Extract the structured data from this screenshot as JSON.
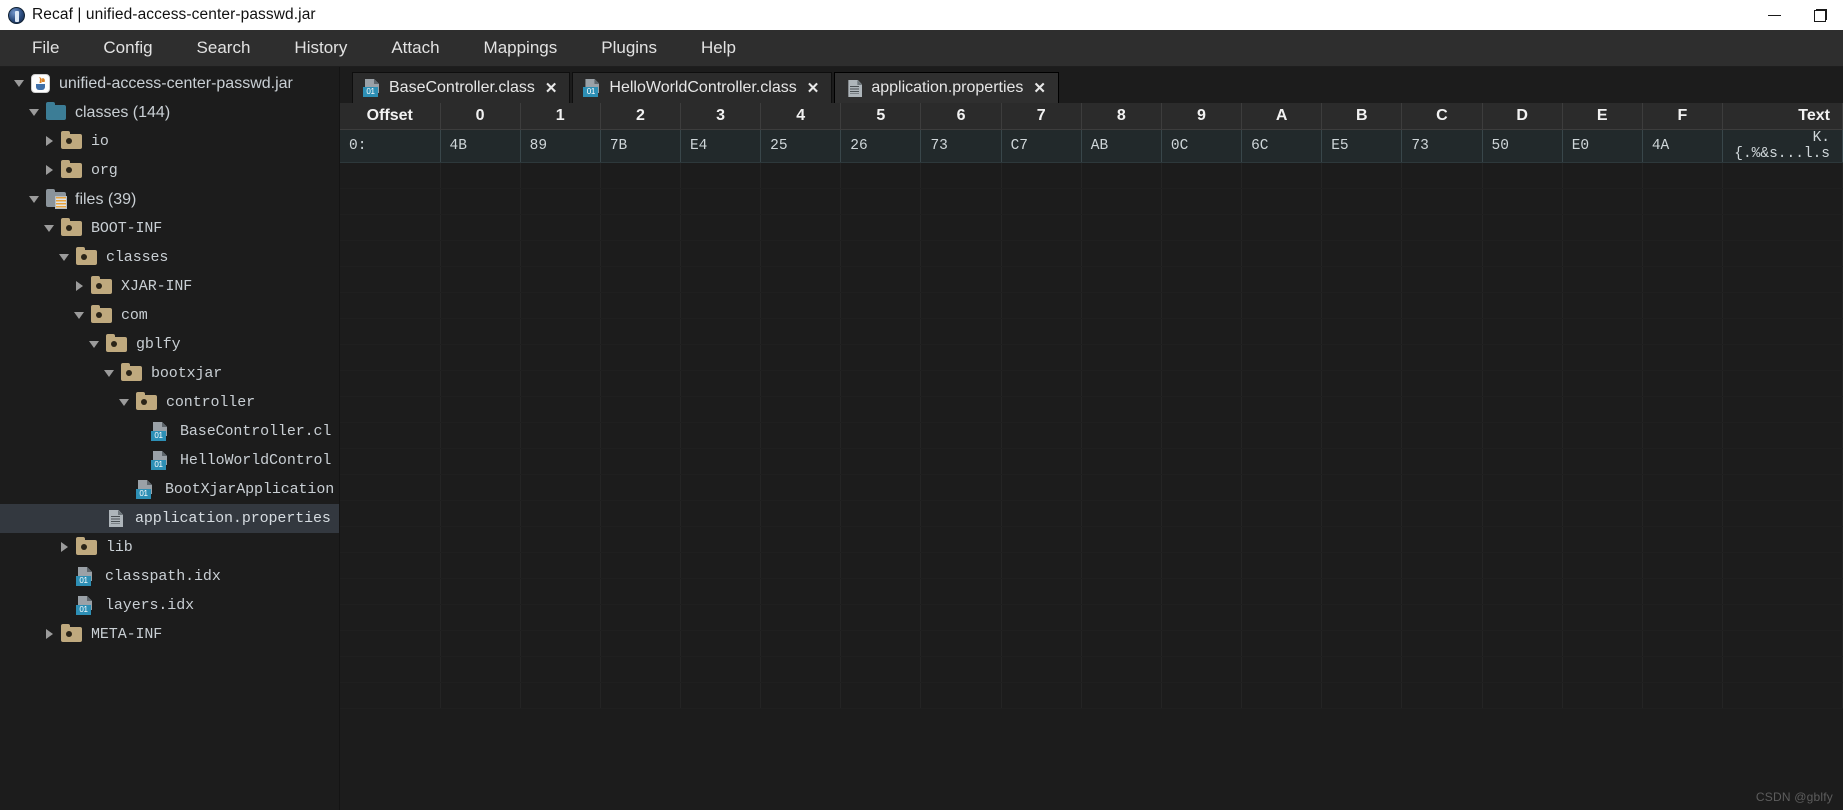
{
  "window": {
    "title": "Recaf | unified-access-center-passwd.jar",
    "app_icon": "recaf-logo-icon",
    "controls": [
      {
        "name": "minimize-button",
        "glyph": "minimize-icon"
      },
      {
        "name": "restore-button",
        "glyph": "restore-icon"
      }
    ]
  },
  "menubar": {
    "items": [
      {
        "label": "File"
      },
      {
        "label": "Config"
      },
      {
        "label": "Search"
      },
      {
        "label": "History"
      },
      {
        "label": "Attach"
      },
      {
        "label": "Mappings"
      },
      {
        "label": "Plugins"
      },
      {
        "label": "Help"
      }
    ]
  },
  "sidebar": {
    "items": [
      {
        "label": "unified-access-center-passwd.jar",
        "indent": 0,
        "twisty": "open",
        "icon": "jar-icon",
        "mono": false,
        "selected": false
      },
      {
        "label": "classes (144)",
        "indent": 1,
        "twisty": "open",
        "icon": "folder-teal-icon",
        "mono": false,
        "selected": false
      },
      {
        "label": "io",
        "indent": 2,
        "twisty": "closed",
        "icon": "folder-icon",
        "mono": true,
        "selected": false
      },
      {
        "label": "org",
        "indent": 2,
        "twisty": "closed",
        "icon": "folder-icon",
        "mono": true,
        "selected": false
      },
      {
        "label": "files (39)",
        "indent": 1,
        "twisty": "open",
        "icon": "folder-files-icon",
        "mono": false,
        "selected": false
      },
      {
        "label": "BOOT-INF",
        "indent": 2,
        "twisty": "open",
        "icon": "folder-icon",
        "mono": true,
        "selected": false
      },
      {
        "label": "classes",
        "indent": 3,
        "twisty": "open",
        "icon": "folder-icon",
        "mono": true,
        "selected": false
      },
      {
        "label": "XJAR-INF",
        "indent": 4,
        "twisty": "closed",
        "icon": "folder-icon",
        "mono": true,
        "selected": false
      },
      {
        "label": "com",
        "indent": 4,
        "twisty": "open",
        "icon": "folder-icon",
        "mono": true,
        "selected": false
      },
      {
        "label": "gblfy",
        "indent": 5,
        "twisty": "open",
        "icon": "folder-icon",
        "mono": true,
        "selected": false
      },
      {
        "label": "bootxjar",
        "indent": 6,
        "twisty": "open",
        "icon": "folder-icon",
        "mono": true,
        "selected": false
      },
      {
        "label": "controller",
        "indent": 7,
        "twisty": "open",
        "icon": "folder-icon",
        "mono": true,
        "selected": false
      },
      {
        "label": "BaseController.cl",
        "indent": 8,
        "twisty": "none",
        "icon": "class-file-icon",
        "mono": true,
        "selected": false
      },
      {
        "label": "HelloWorldControl",
        "indent": 8,
        "twisty": "none",
        "icon": "class-file-icon",
        "mono": true,
        "selected": false
      },
      {
        "label": "BootXjarApplication",
        "indent": 7,
        "twisty": "none",
        "icon": "class-file-icon",
        "mono": true,
        "selected": false
      },
      {
        "label": "application.properties",
        "indent": 5,
        "twisty": "none",
        "icon": "text-file-icon",
        "mono": true,
        "selected": true
      },
      {
        "label": "lib",
        "indent": 3,
        "twisty": "closed",
        "icon": "folder-icon",
        "mono": true,
        "selected": false
      },
      {
        "label": "classpath.idx",
        "indent": 3,
        "twisty": "none",
        "icon": "class-file-icon",
        "mono": true,
        "selected": false
      },
      {
        "label": "layers.idx",
        "indent": 3,
        "twisty": "none",
        "icon": "class-file-icon",
        "mono": true,
        "selected": false
      },
      {
        "label": "META-INF",
        "indent": 2,
        "twisty": "closed",
        "icon": "folder-icon",
        "mono": true,
        "selected": false
      }
    ]
  },
  "tabs": [
    {
      "label": "BaseController.class",
      "icon": "class-file-icon",
      "close": "✕",
      "active": false
    },
    {
      "label": "HelloWorldController.class",
      "icon": "class-file-icon",
      "close": "✕",
      "active": false
    },
    {
      "label": "application.properties",
      "icon": "text-file-icon",
      "close": "✕",
      "active": true
    }
  ],
  "hex_view": {
    "headers": [
      "Offset",
      "0",
      "1",
      "2",
      "3",
      "4",
      "5",
      "6",
      "7",
      "8",
      "9",
      "A",
      "B",
      "C",
      "D",
      "E",
      "F",
      "Text"
    ],
    "rows": [
      {
        "offset": "0:",
        "bytes": [
          "4B",
          "89",
          "7B",
          "E4",
          "25",
          "26",
          "73",
          "C7",
          "AB",
          "0C",
          "6C",
          "E5",
          "73",
          "50",
          "E0",
          "4A"
        ],
        "text": "K.{.%&s...l.s"
      }
    ],
    "blank_row_count": 21
  },
  "watermark": "CSDN @gblfy",
  "colors": {
    "titlebar_bg": "#ffffff",
    "menubar_bg": "#2e2e2e",
    "panel_bg": "#1c1c1c",
    "tab_active_bg": "#2f2f2f",
    "hex_header_bg": "#2b2b2b",
    "hex_row_bg": "#22292b",
    "selection_bg": "#33383f",
    "accent_teal": "#2d8fb5",
    "folder_tan": "#bfa97e"
  }
}
